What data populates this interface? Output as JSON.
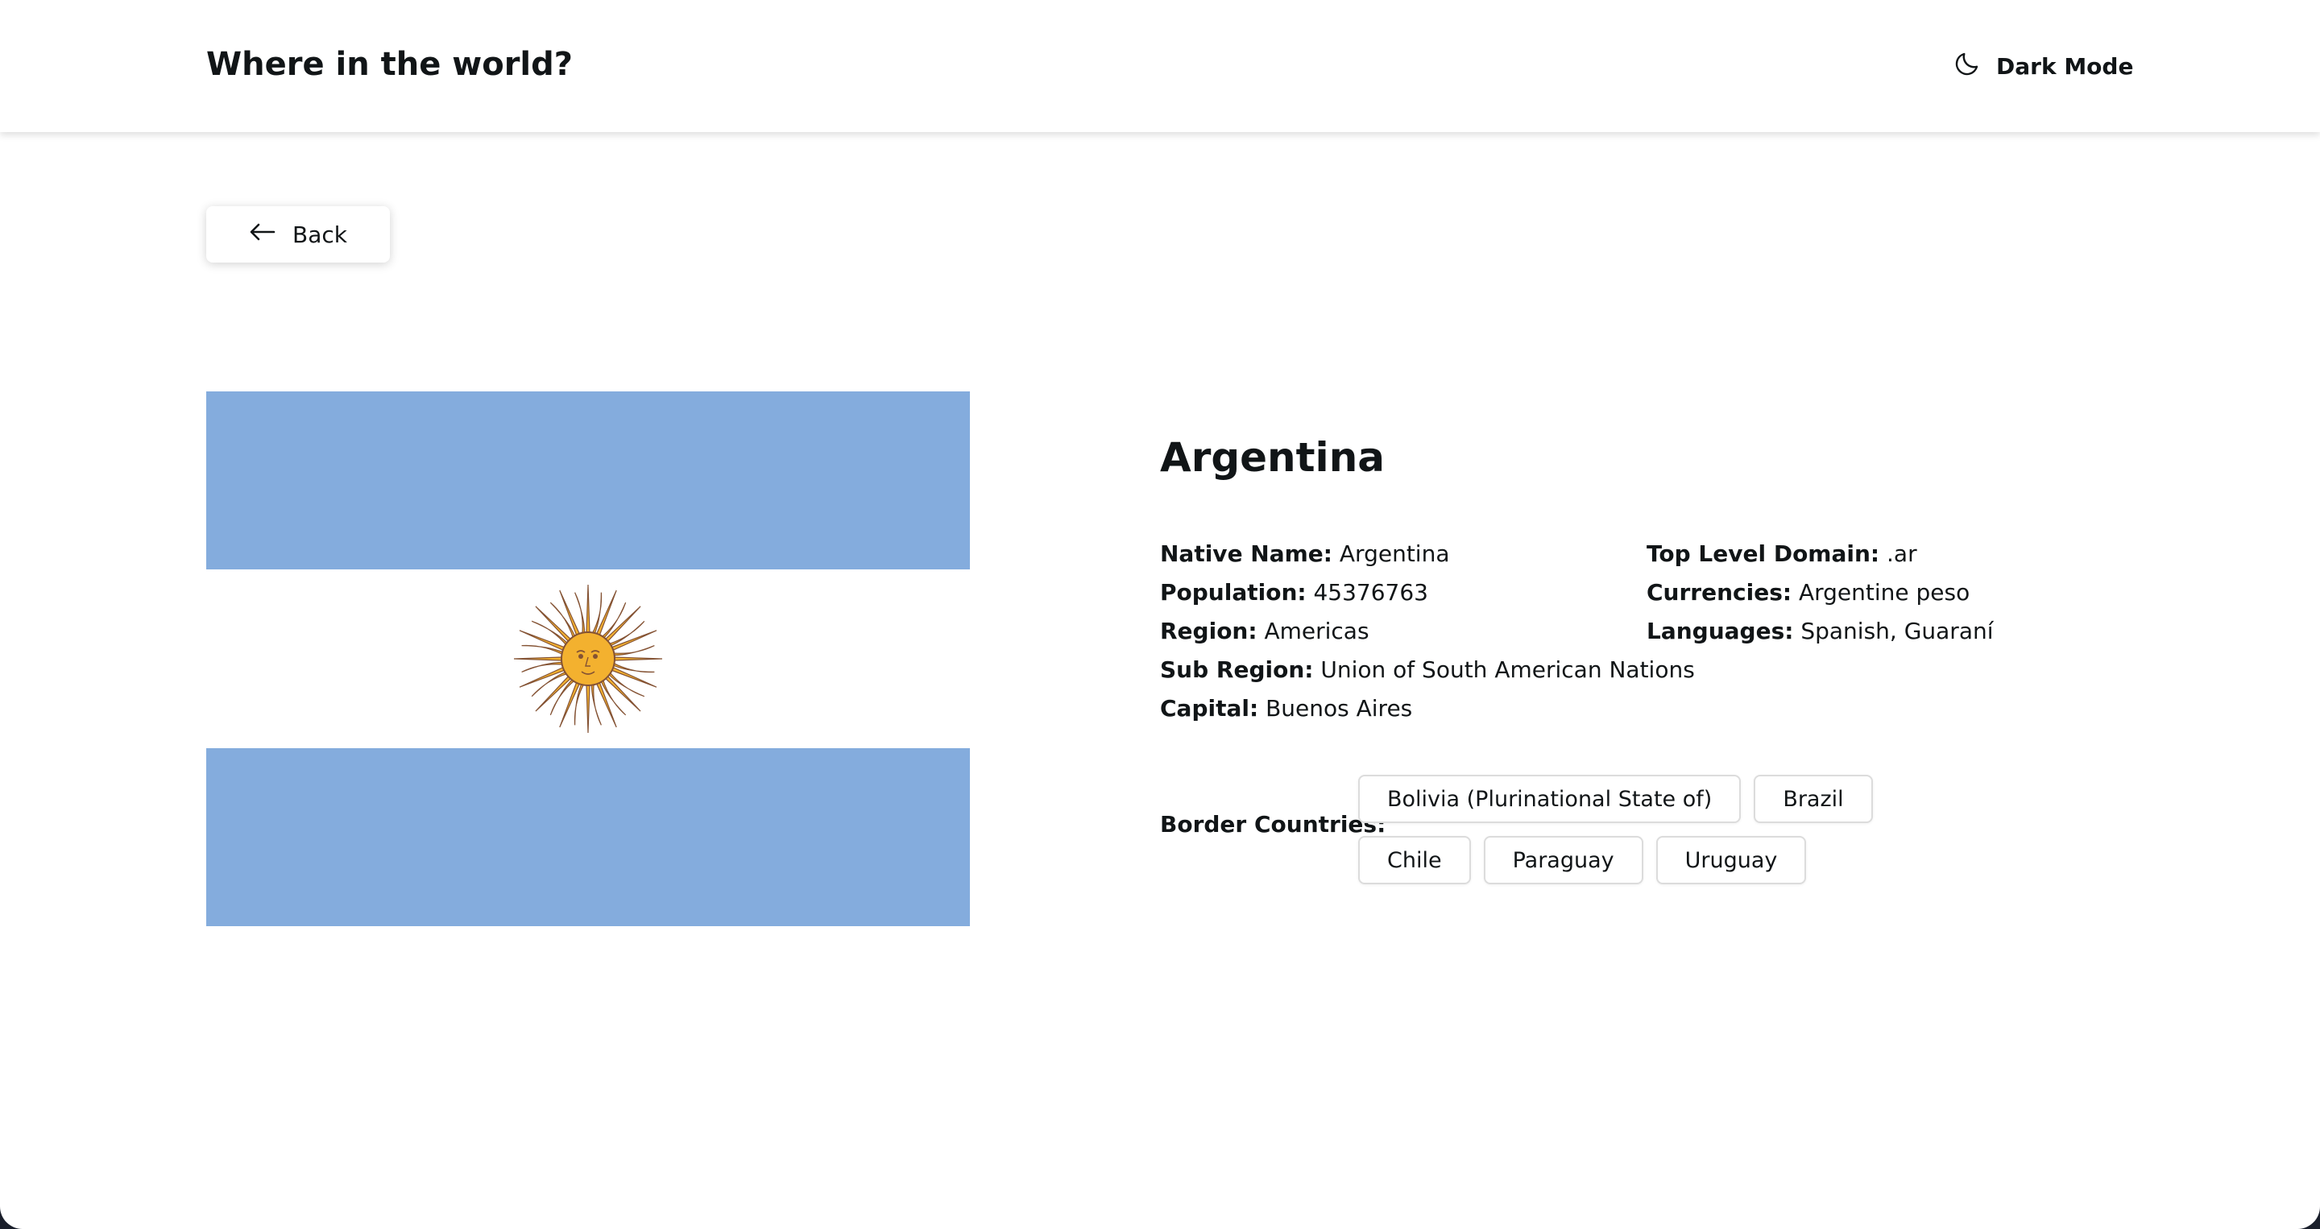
{
  "header": {
    "title": "Where in the world?",
    "dark_mode_label": "Dark Mode",
    "dark_mode_icon": "moon-icon"
  },
  "back": {
    "label": "Back",
    "icon": "arrow-left-icon"
  },
  "flag": {
    "icon": "argentina-flag",
    "colors": {
      "stripe": "#84acdd",
      "white": "#ffffff",
      "sun": "#f3b12f",
      "sun_outline": "#845233"
    }
  },
  "country": {
    "name": "Argentina",
    "details_left": [
      {
        "label": "Native Name:",
        "value": "Argentina"
      },
      {
        "label": "Population:",
        "value": "45376763"
      },
      {
        "label": "Region:",
        "value": "Americas"
      },
      {
        "label": "Sub Region:",
        "value": "Union of South American Nations"
      },
      {
        "label": "Capital:",
        "value": "Buenos Aires"
      }
    ],
    "details_right": [
      {
        "label": "Top Level Domain:",
        "value": ".ar"
      },
      {
        "label": "Currencies:",
        "value": "Argentine peso"
      },
      {
        "label": "Languages:",
        "value": "Spanish, Guaraní"
      }
    ],
    "border_label": "Border Countries:",
    "borders": [
      "Bolivia (Plurinational State of)",
      "Brazil",
      "Chile",
      "Paraguay",
      "Uruguay"
    ]
  }
}
